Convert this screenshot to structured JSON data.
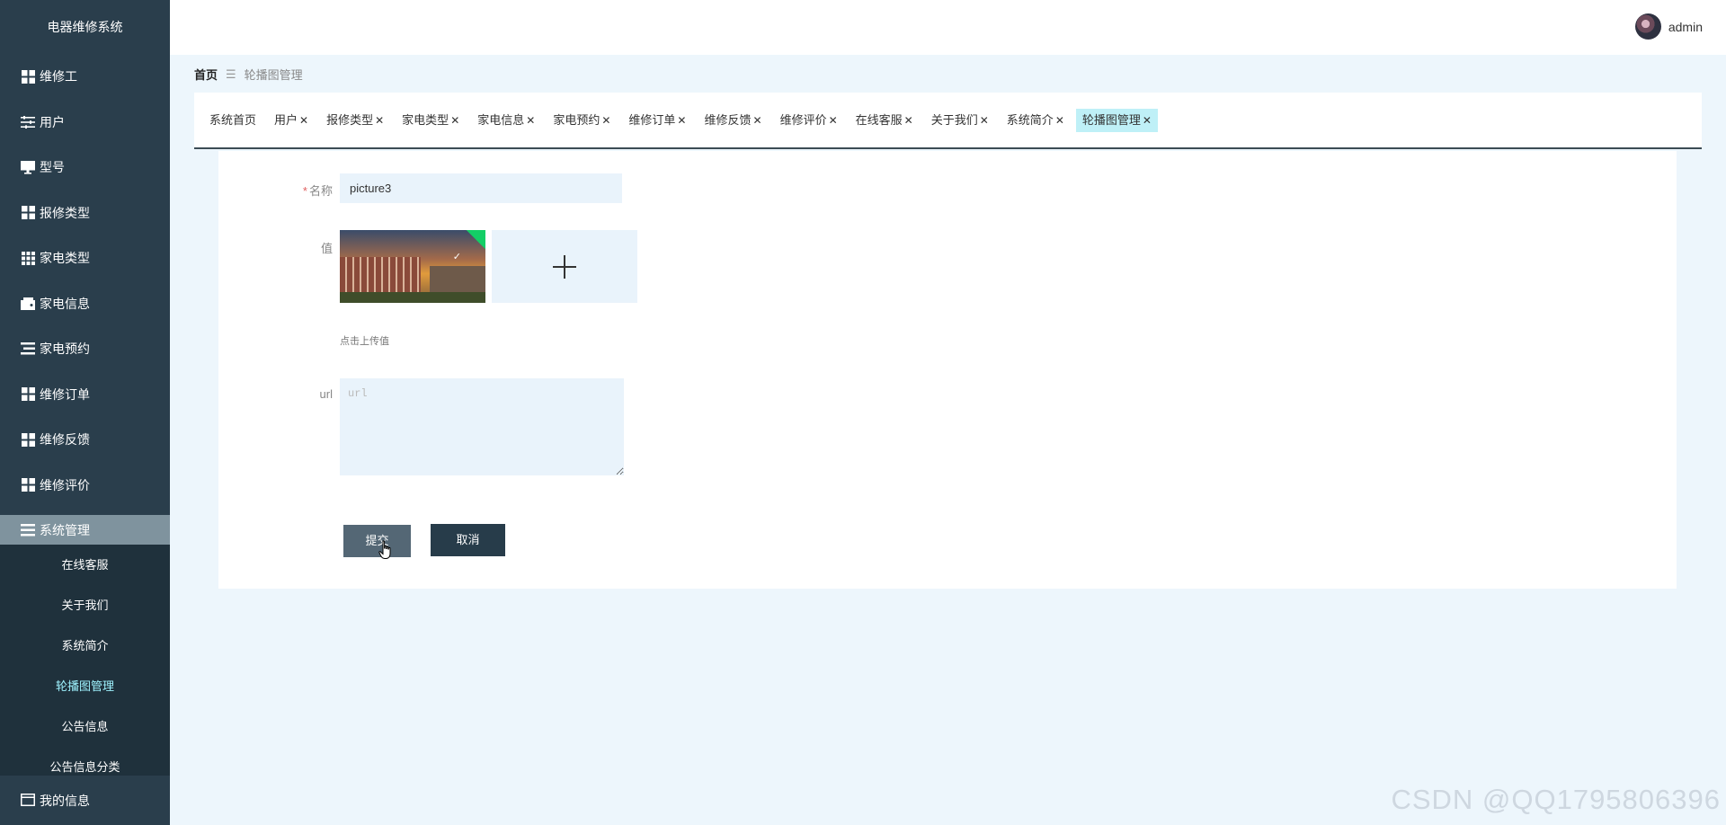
{
  "sidebar": {
    "title": "电器维修系统",
    "items": [
      {
        "label": "维修工",
        "icon": "grid-icon"
      },
      {
        "label": "用户",
        "icon": "sliders-icon"
      },
      {
        "label": "型号",
        "icon": "monitor-icon"
      },
      {
        "label": "报修类型",
        "icon": "grid-icon"
      },
      {
        "label": "家电类型",
        "icon": "grid-small-icon"
      },
      {
        "label": "家电信息",
        "icon": "wallet-icon"
      },
      {
        "label": "家电预约",
        "icon": "list-icon"
      },
      {
        "label": "维修订单",
        "icon": "grid-icon"
      },
      {
        "label": "维修反馈",
        "icon": "grid-icon"
      },
      {
        "label": "维修评价",
        "icon": "grid-icon"
      }
    ],
    "active_group": {
      "label": "系统管理",
      "icon": "list-icon"
    },
    "sub_items": [
      {
        "label": "在线客服"
      },
      {
        "label": "关于我们"
      },
      {
        "label": "系统简介"
      },
      {
        "label": "轮播图管理",
        "active": true
      },
      {
        "label": "公告信息"
      },
      {
        "label": "公告信息分类"
      }
    ],
    "bottom_item": {
      "label": "我的信息",
      "icon": "card-icon"
    }
  },
  "header": {
    "username": "admin"
  },
  "breadcrumb": {
    "home": "首页",
    "separator": "☰",
    "current": "轮播图管理"
  },
  "tabs": [
    {
      "label": "系统首页",
      "closable": false
    },
    {
      "label": "用户",
      "closable": true
    },
    {
      "label": "报修类型",
      "closable": true
    },
    {
      "label": "家电类型",
      "closable": true
    },
    {
      "label": "家电信息",
      "closable": true
    },
    {
      "label": "家电预约",
      "closable": true
    },
    {
      "label": "维修订单",
      "closable": true
    },
    {
      "label": "维修反馈",
      "closable": true
    },
    {
      "label": "维修评价",
      "closable": true
    },
    {
      "label": "在线客服",
      "closable": true
    },
    {
      "label": "关于我们",
      "closable": true
    },
    {
      "label": "系统简介",
      "closable": true
    },
    {
      "label": "轮播图管理",
      "closable": true,
      "active": true
    }
  ],
  "form": {
    "name_label": "名称",
    "name_required": "*",
    "name_value": "picture3",
    "value_label": "值",
    "upload_hint": "点击上传值",
    "url_label": "url",
    "url_placeholder": "url",
    "submit_label": "提交",
    "cancel_label": "取消"
  },
  "watermark": "CSDN @QQ1795806396",
  "colors": {
    "sidebar_bg": "#2a3e4c",
    "active_tab": "#bff0f7",
    "active_submenu_text": "#9ff3ff",
    "page_bg": "#edf6fc",
    "submit_btn": "#546775",
    "cancel_btn": "#273c4a"
  }
}
